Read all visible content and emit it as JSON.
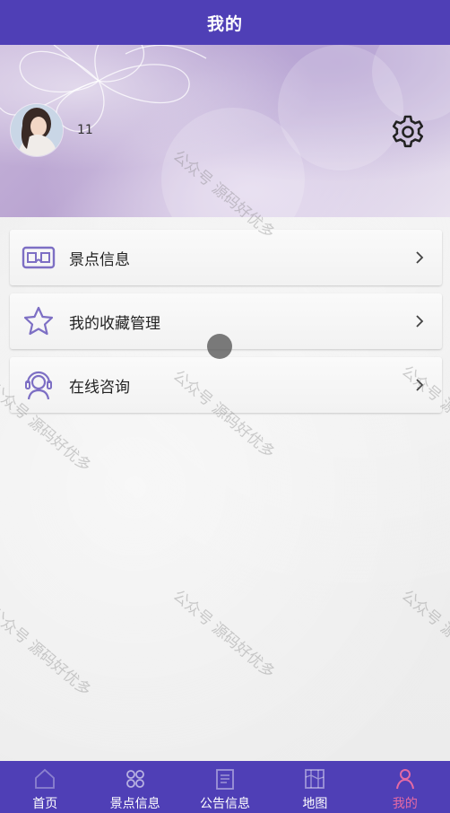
{
  "header": {
    "title": "我的"
  },
  "profile": {
    "username": "11"
  },
  "menu": {
    "items": [
      {
        "label": "景点信息",
        "icon": "vr-glasses-icon"
      },
      {
        "label": "我的收藏管理",
        "icon": "star-icon"
      },
      {
        "label": "在线咨询",
        "icon": "support-agent-icon"
      }
    ]
  },
  "tabbar": {
    "items": [
      {
        "label": "首页",
        "icon": "home-icon",
        "active": false
      },
      {
        "label": "景点信息",
        "icon": "grid-icon",
        "active": false
      },
      {
        "label": "公告信息",
        "icon": "notice-icon",
        "active": false
      },
      {
        "label": "地图",
        "icon": "map-icon",
        "active": false
      },
      {
        "label": "我的",
        "icon": "user-icon",
        "active": true
      }
    ]
  },
  "watermark": {
    "text": "公众号 源码好优多"
  },
  "colors": {
    "primary": "#4f3fb6",
    "active_tab": "#e46aa4",
    "menu_icon": "#7d6fc4"
  }
}
